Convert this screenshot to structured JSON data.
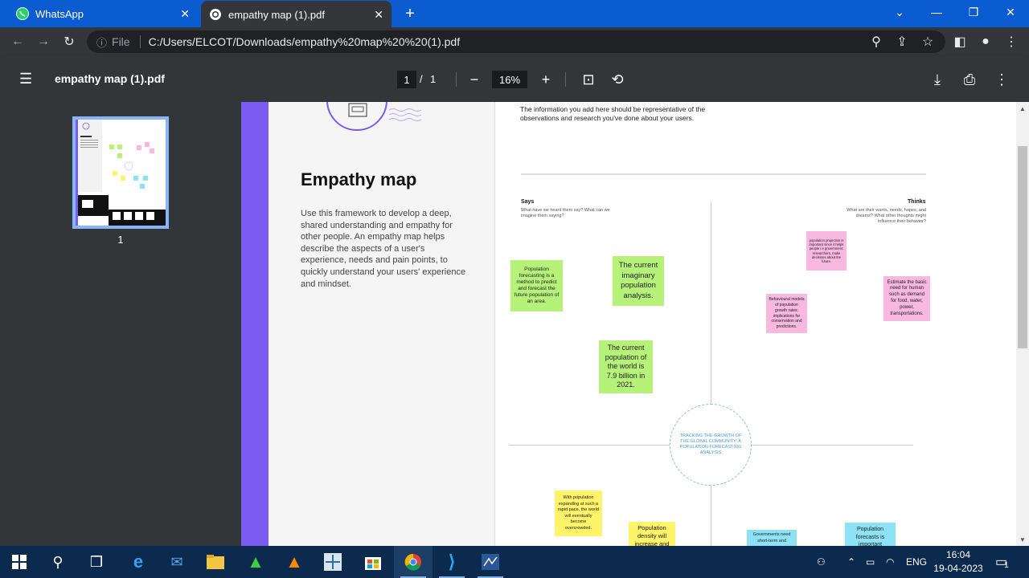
{
  "browser": {
    "tabs": [
      {
        "title": "WhatsApp",
        "icon": "whatsapp-icon"
      },
      {
        "title": "empathy map (1).pdf",
        "icon": "globe-icon"
      }
    ],
    "address": {
      "scheme_label": "File",
      "url": "C:/Users/ELCOT/Downloads/empathy%20map%20%20(1).pdf"
    }
  },
  "pdf_viewer": {
    "title": "empathy map (1).pdf",
    "current_page": "1",
    "page_separator": "/",
    "total_pages": "1",
    "zoom": "16%",
    "thumbnail_label": "1"
  },
  "document": {
    "info_text": "The information you add here should be representative of the observations and research you've done about your users.",
    "title": "Empathy map",
    "description": "Use this framework to develop a deep, shared understanding and empathy for other people. An empathy map helps describe the aspects of a user's experience, needs and pain points, to quickly understand your users' experience and mindset.",
    "says": {
      "heading": "Says",
      "subtitle": "What have we heard them say? What can we imagine them saying?"
    },
    "thinks": {
      "heading": "Thinks",
      "subtitle": "What are their wants, needs, hopes, and dreams? What other thoughts might influence their behavior?"
    },
    "center_label": "TRACKING THE GROWTH OF THE GLOBAL COMMUNITY: A POPULATION FORECASTING ANALYSIS",
    "notes": {
      "n1": "Population forecasting is a method to predict and forecast the future population of an area.",
      "n2": "The current imaginary population analysis.",
      "n3": "The current population of the world is 7.9 billion in 2021.",
      "n4": "population projection is important since it helps people i.e government, researchers, make decisions about the future.",
      "n5": "Estimate the basic need for human such as demand for food, water, power, transportations.",
      "n6": "Behavioural models of population growth rates: implications for conservation and predictions.",
      "n7": "With population expanding at such a rapid pace, the world will eventually become overcrowded.",
      "n8": "Population density will increase and",
      "n9": "Governments need short-term and",
      "n10": "Population forecasts is important"
    },
    "colors": {
      "accent": "#7b5cf2",
      "green_note": "#b6f27a",
      "pink_note": "#f8b8e0",
      "yellow_note": "#fff36a",
      "cyan_note": "#8de3f5"
    }
  },
  "taskbar": {
    "language": "ENG",
    "time": "16:04",
    "date": "19-04-2023",
    "notification_count": "1"
  }
}
